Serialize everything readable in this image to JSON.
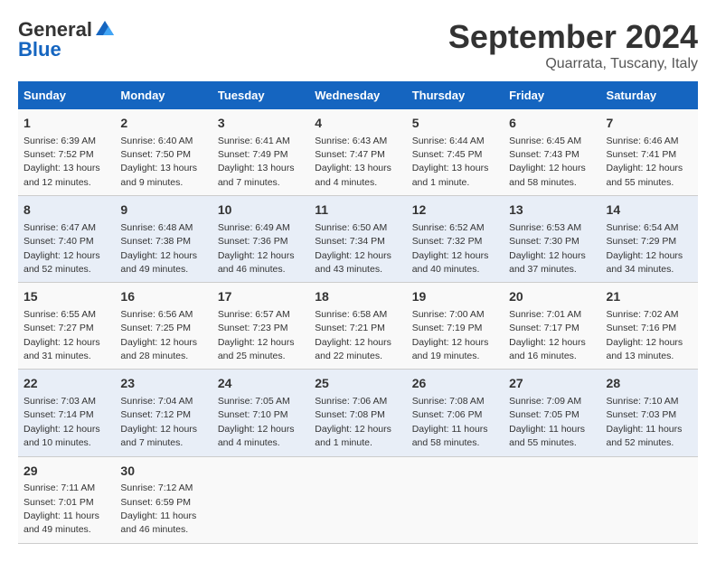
{
  "header": {
    "logo_general": "General",
    "logo_blue": "Blue",
    "month": "September 2024",
    "location": "Quarrata, Tuscany, Italy"
  },
  "days_of_week": [
    "Sunday",
    "Monday",
    "Tuesday",
    "Wednesday",
    "Thursday",
    "Friday",
    "Saturday"
  ],
  "weeks": [
    [
      {
        "day": "1",
        "sunrise": "Sunrise: 6:39 AM",
        "sunset": "Sunset: 7:52 PM",
        "daylight": "Daylight: 13 hours and 12 minutes."
      },
      {
        "day": "2",
        "sunrise": "Sunrise: 6:40 AM",
        "sunset": "Sunset: 7:50 PM",
        "daylight": "Daylight: 13 hours and 9 minutes."
      },
      {
        "day": "3",
        "sunrise": "Sunrise: 6:41 AM",
        "sunset": "Sunset: 7:49 PM",
        "daylight": "Daylight: 13 hours and 7 minutes."
      },
      {
        "day": "4",
        "sunrise": "Sunrise: 6:43 AM",
        "sunset": "Sunset: 7:47 PM",
        "daylight": "Daylight: 13 hours and 4 minutes."
      },
      {
        "day": "5",
        "sunrise": "Sunrise: 6:44 AM",
        "sunset": "Sunset: 7:45 PM",
        "daylight": "Daylight: 13 hours and 1 minute."
      },
      {
        "day": "6",
        "sunrise": "Sunrise: 6:45 AM",
        "sunset": "Sunset: 7:43 PM",
        "daylight": "Daylight: 12 hours and 58 minutes."
      },
      {
        "day": "7",
        "sunrise": "Sunrise: 6:46 AM",
        "sunset": "Sunset: 7:41 PM",
        "daylight": "Daylight: 12 hours and 55 minutes."
      }
    ],
    [
      {
        "day": "8",
        "sunrise": "Sunrise: 6:47 AM",
        "sunset": "Sunset: 7:40 PM",
        "daylight": "Daylight: 12 hours and 52 minutes."
      },
      {
        "day": "9",
        "sunrise": "Sunrise: 6:48 AM",
        "sunset": "Sunset: 7:38 PM",
        "daylight": "Daylight: 12 hours and 49 minutes."
      },
      {
        "day": "10",
        "sunrise": "Sunrise: 6:49 AM",
        "sunset": "Sunset: 7:36 PM",
        "daylight": "Daylight: 12 hours and 46 minutes."
      },
      {
        "day": "11",
        "sunrise": "Sunrise: 6:50 AM",
        "sunset": "Sunset: 7:34 PM",
        "daylight": "Daylight: 12 hours and 43 minutes."
      },
      {
        "day": "12",
        "sunrise": "Sunrise: 6:52 AM",
        "sunset": "Sunset: 7:32 PM",
        "daylight": "Daylight: 12 hours and 40 minutes."
      },
      {
        "day": "13",
        "sunrise": "Sunrise: 6:53 AM",
        "sunset": "Sunset: 7:30 PM",
        "daylight": "Daylight: 12 hours and 37 minutes."
      },
      {
        "day": "14",
        "sunrise": "Sunrise: 6:54 AM",
        "sunset": "Sunset: 7:29 PM",
        "daylight": "Daylight: 12 hours and 34 minutes."
      }
    ],
    [
      {
        "day": "15",
        "sunrise": "Sunrise: 6:55 AM",
        "sunset": "Sunset: 7:27 PM",
        "daylight": "Daylight: 12 hours and 31 minutes."
      },
      {
        "day": "16",
        "sunrise": "Sunrise: 6:56 AM",
        "sunset": "Sunset: 7:25 PM",
        "daylight": "Daylight: 12 hours and 28 minutes."
      },
      {
        "day": "17",
        "sunrise": "Sunrise: 6:57 AM",
        "sunset": "Sunset: 7:23 PM",
        "daylight": "Daylight: 12 hours and 25 minutes."
      },
      {
        "day": "18",
        "sunrise": "Sunrise: 6:58 AM",
        "sunset": "Sunset: 7:21 PM",
        "daylight": "Daylight: 12 hours and 22 minutes."
      },
      {
        "day": "19",
        "sunrise": "Sunrise: 7:00 AM",
        "sunset": "Sunset: 7:19 PM",
        "daylight": "Daylight: 12 hours and 19 minutes."
      },
      {
        "day": "20",
        "sunrise": "Sunrise: 7:01 AM",
        "sunset": "Sunset: 7:17 PM",
        "daylight": "Daylight: 12 hours and 16 minutes."
      },
      {
        "day": "21",
        "sunrise": "Sunrise: 7:02 AM",
        "sunset": "Sunset: 7:16 PM",
        "daylight": "Daylight: 12 hours and 13 minutes."
      }
    ],
    [
      {
        "day": "22",
        "sunrise": "Sunrise: 7:03 AM",
        "sunset": "Sunset: 7:14 PM",
        "daylight": "Daylight: 12 hours and 10 minutes."
      },
      {
        "day": "23",
        "sunrise": "Sunrise: 7:04 AM",
        "sunset": "Sunset: 7:12 PM",
        "daylight": "Daylight: 12 hours and 7 minutes."
      },
      {
        "day": "24",
        "sunrise": "Sunrise: 7:05 AM",
        "sunset": "Sunset: 7:10 PM",
        "daylight": "Daylight: 12 hours and 4 minutes."
      },
      {
        "day": "25",
        "sunrise": "Sunrise: 7:06 AM",
        "sunset": "Sunset: 7:08 PM",
        "daylight": "Daylight: 12 hours and 1 minute."
      },
      {
        "day": "26",
        "sunrise": "Sunrise: 7:08 AM",
        "sunset": "Sunset: 7:06 PM",
        "daylight": "Daylight: 11 hours and 58 minutes."
      },
      {
        "day": "27",
        "sunrise": "Sunrise: 7:09 AM",
        "sunset": "Sunset: 7:05 PM",
        "daylight": "Daylight: 11 hours and 55 minutes."
      },
      {
        "day": "28",
        "sunrise": "Sunrise: 7:10 AM",
        "sunset": "Sunset: 7:03 PM",
        "daylight": "Daylight: 11 hours and 52 minutes."
      }
    ],
    [
      {
        "day": "29",
        "sunrise": "Sunrise: 7:11 AM",
        "sunset": "Sunset: 7:01 PM",
        "daylight": "Daylight: 11 hours and 49 minutes."
      },
      {
        "day": "30",
        "sunrise": "Sunrise: 7:12 AM",
        "sunset": "Sunset: 6:59 PM",
        "daylight": "Daylight: 11 hours and 46 minutes."
      },
      {
        "day": "",
        "sunrise": "",
        "sunset": "",
        "daylight": ""
      },
      {
        "day": "",
        "sunrise": "",
        "sunset": "",
        "daylight": ""
      },
      {
        "day": "",
        "sunrise": "",
        "sunset": "",
        "daylight": ""
      },
      {
        "day": "",
        "sunrise": "",
        "sunset": "",
        "daylight": ""
      },
      {
        "day": "",
        "sunrise": "",
        "sunset": "",
        "daylight": ""
      }
    ]
  ]
}
